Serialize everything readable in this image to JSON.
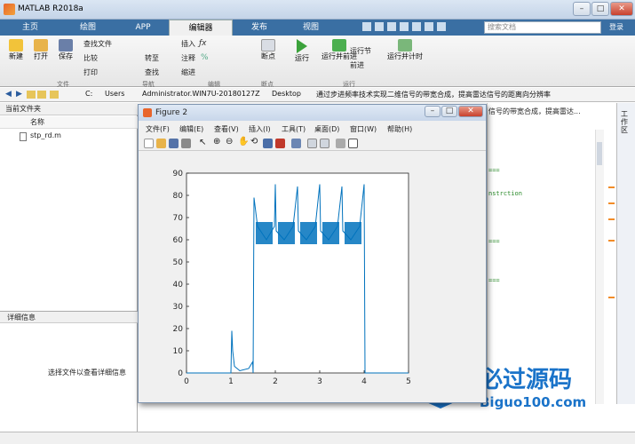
{
  "window": {
    "title": "MATLAB R2018a",
    "search_placeholder": "搜索文档",
    "login": "登录"
  },
  "tabs": [
    "主页",
    "绘图",
    "APP",
    "编辑器",
    "发布",
    "视图"
  ],
  "ribbon": {
    "file": {
      "new": "新建",
      "open": "打开",
      "save": "保存",
      "find_files": "查找文件",
      "compare": "比较",
      "print": "打印",
      "group": "文件"
    },
    "navigate": {
      "goto": "转至",
      "find": "查找",
      "group": "导航"
    },
    "edit": {
      "insert": "插入",
      "comment": "注释",
      "indent": "缩进",
      "group": "编辑"
    },
    "breakpoints": {
      "label": "断点",
      "group": "断点"
    },
    "run": {
      "run": "运行",
      "run_advance": "运行并前进",
      "run_section": "运行节",
      "advance": "前进",
      "run_time": "运行并计时",
      "group": "运行"
    }
  },
  "path": {
    "drive": "C:",
    "p1": "Users",
    "p2": "Administrator.WIN7U-20180127Z",
    "p3": "Desktop",
    "p4": "通过步进频率技术实现二维信号的带宽合成，提高雷达信号的距离向分辨率"
  },
  "left": {
    "header": "当前文件夹",
    "col_name": "名称",
    "file": "stp_rd.m",
    "details_header": "详细信息",
    "details_hint": "选择文件以查看详细信息"
  },
  "editor": {
    "tab_title": "信号的带宽合成，提高雷达...",
    "line1": "===",
    "line2": "nstrction",
    "line3": "===",
    "line4": "==="
  },
  "right_label": "工作区",
  "figure": {
    "title": "Figure 2",
    "menu": [
      "文件(F)",
      "编辑(E)",
      "查看(V)",
      "插入(I)",
      "工具(T)",
      "桌面(D)",
      "窗口(W)",
      "帮助(H)"
    ]
  },
  "watermark": {
    "cn": "必过源码",
    "url": "Biguo100.com"
  },
  "chart_data": {
    "type": "line",
    "xlim": [
      0,
      5
    ],
    "ylim": [
      0,
      90
    ],
    "xticks": [
      0,
      1,
      2,
      3,
      4,
      5
    ],
    "yticks": [
      0,
      10,
      20,
      30,
      40,
      50,
      60,
      70,
      80,
      90
    ],
    "grid": false,
    "color": "#0072bd",
    "x": [
      0,
      1.0,
      1.02,
      1.04,
      1.08,
      1.2,
      1.4,
      1.49,
      1.5,
      1.52,
      1.6,
      1.8,
      1.98,
      2.0,
      2.02,
      2.2,
      2.4,
      2.5,
      2.52,
      2.7,
      2.9,
      3.0,
      3.02,
      3.2,
      3.4,
      3.5,
      3.52,
      3.7,
      3.9,
      4.0,
      4.02,
      4.05,
      4.1,
      5.0
    ],
    "y": [
      0,
      0,
      19,
      10,
      3,
      1,
      2,
      5,
      0,
      79,
      66,
      60,
      66,
      85,
      64,
      60,
      66,
      84,
      64,
      60,
      66,
      85,
      64,
      60,
      66,
      84,
      64,
      60,
      66,
      85,
      0,
      0,
      0,
      0
    ]
  }
}
